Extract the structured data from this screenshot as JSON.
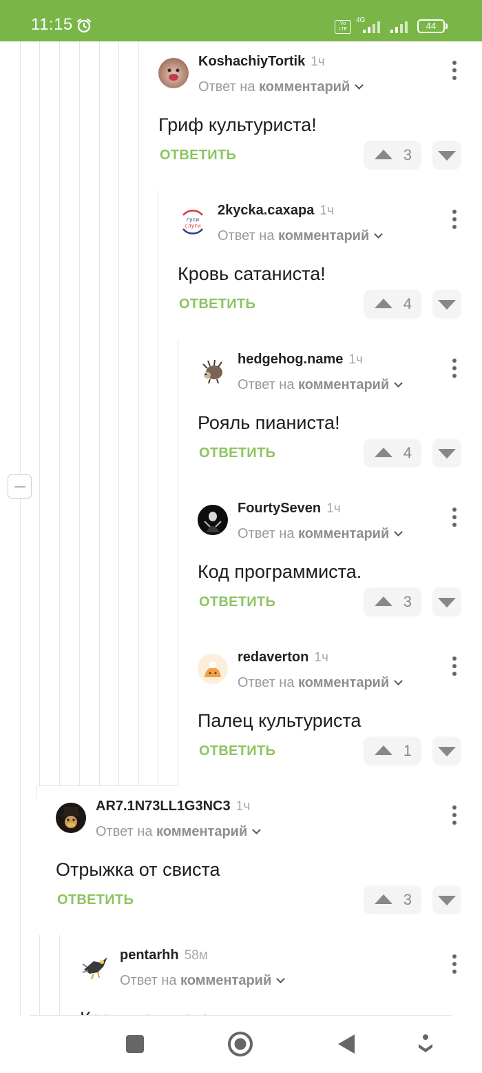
{
  "status_bar": {
    "time": "11:15",
    "alarm_icon": "alarm-clock-icon",
    "volte_label": "Vo LTE",
    "network_type": "4G",
    "battery": "44",
    "background_color": "#79b547"
  },
  "comment_ui": {
    "reply_prefix": "Ответ на",
    "reply_target": "комментарий",
    "reply_button_label": "ОТВЕТИТЬ",
    "accent_color": "#8cc460"
  },
  "comments": [
    {
      "author": "KoshachiyTortik",
      "time": "1ч",
      "text": "Гриф культуриста!",
      "votes": "3"
    },
    {
      "author": "2kycka.сахара",
      "time": "1ч",
      "text": "Кровь сатаниста!",
      "votes": "4",
      "avatar_text": "гуси слуги"
    },
    {
      "author": "hedgehog.name",
      "time": "1ч",
      "text": "Рояль пианиста!",
      "votes": "4"
    },
    {
      "author": "FourtySeven",
      "time": "1ч",
      "text": "Код программиста.",
      "votes": "3"
    },
    {
      "author": "redaverton",
      "time": "1ч",
      "text": "Палец культуриста",
      "votes": "1"
    },
    {
      "author": "AR7.1N73LL1G3NC3",
      "time": "1ч",
      "text": "Отрыжка от свиста",
      "votes": "3"
    },
    {
      "author": "pentarhh",
      "time": "58м",
      "text": "Каску панкиста",
      "votes": ""
    }
  ],
  "nav_bar": {
    "buttons": [
      "square-icon",
      "home-circle-icon",
      "back-triangle-icon",
      "assistant-icon"
    ]
  }
}
